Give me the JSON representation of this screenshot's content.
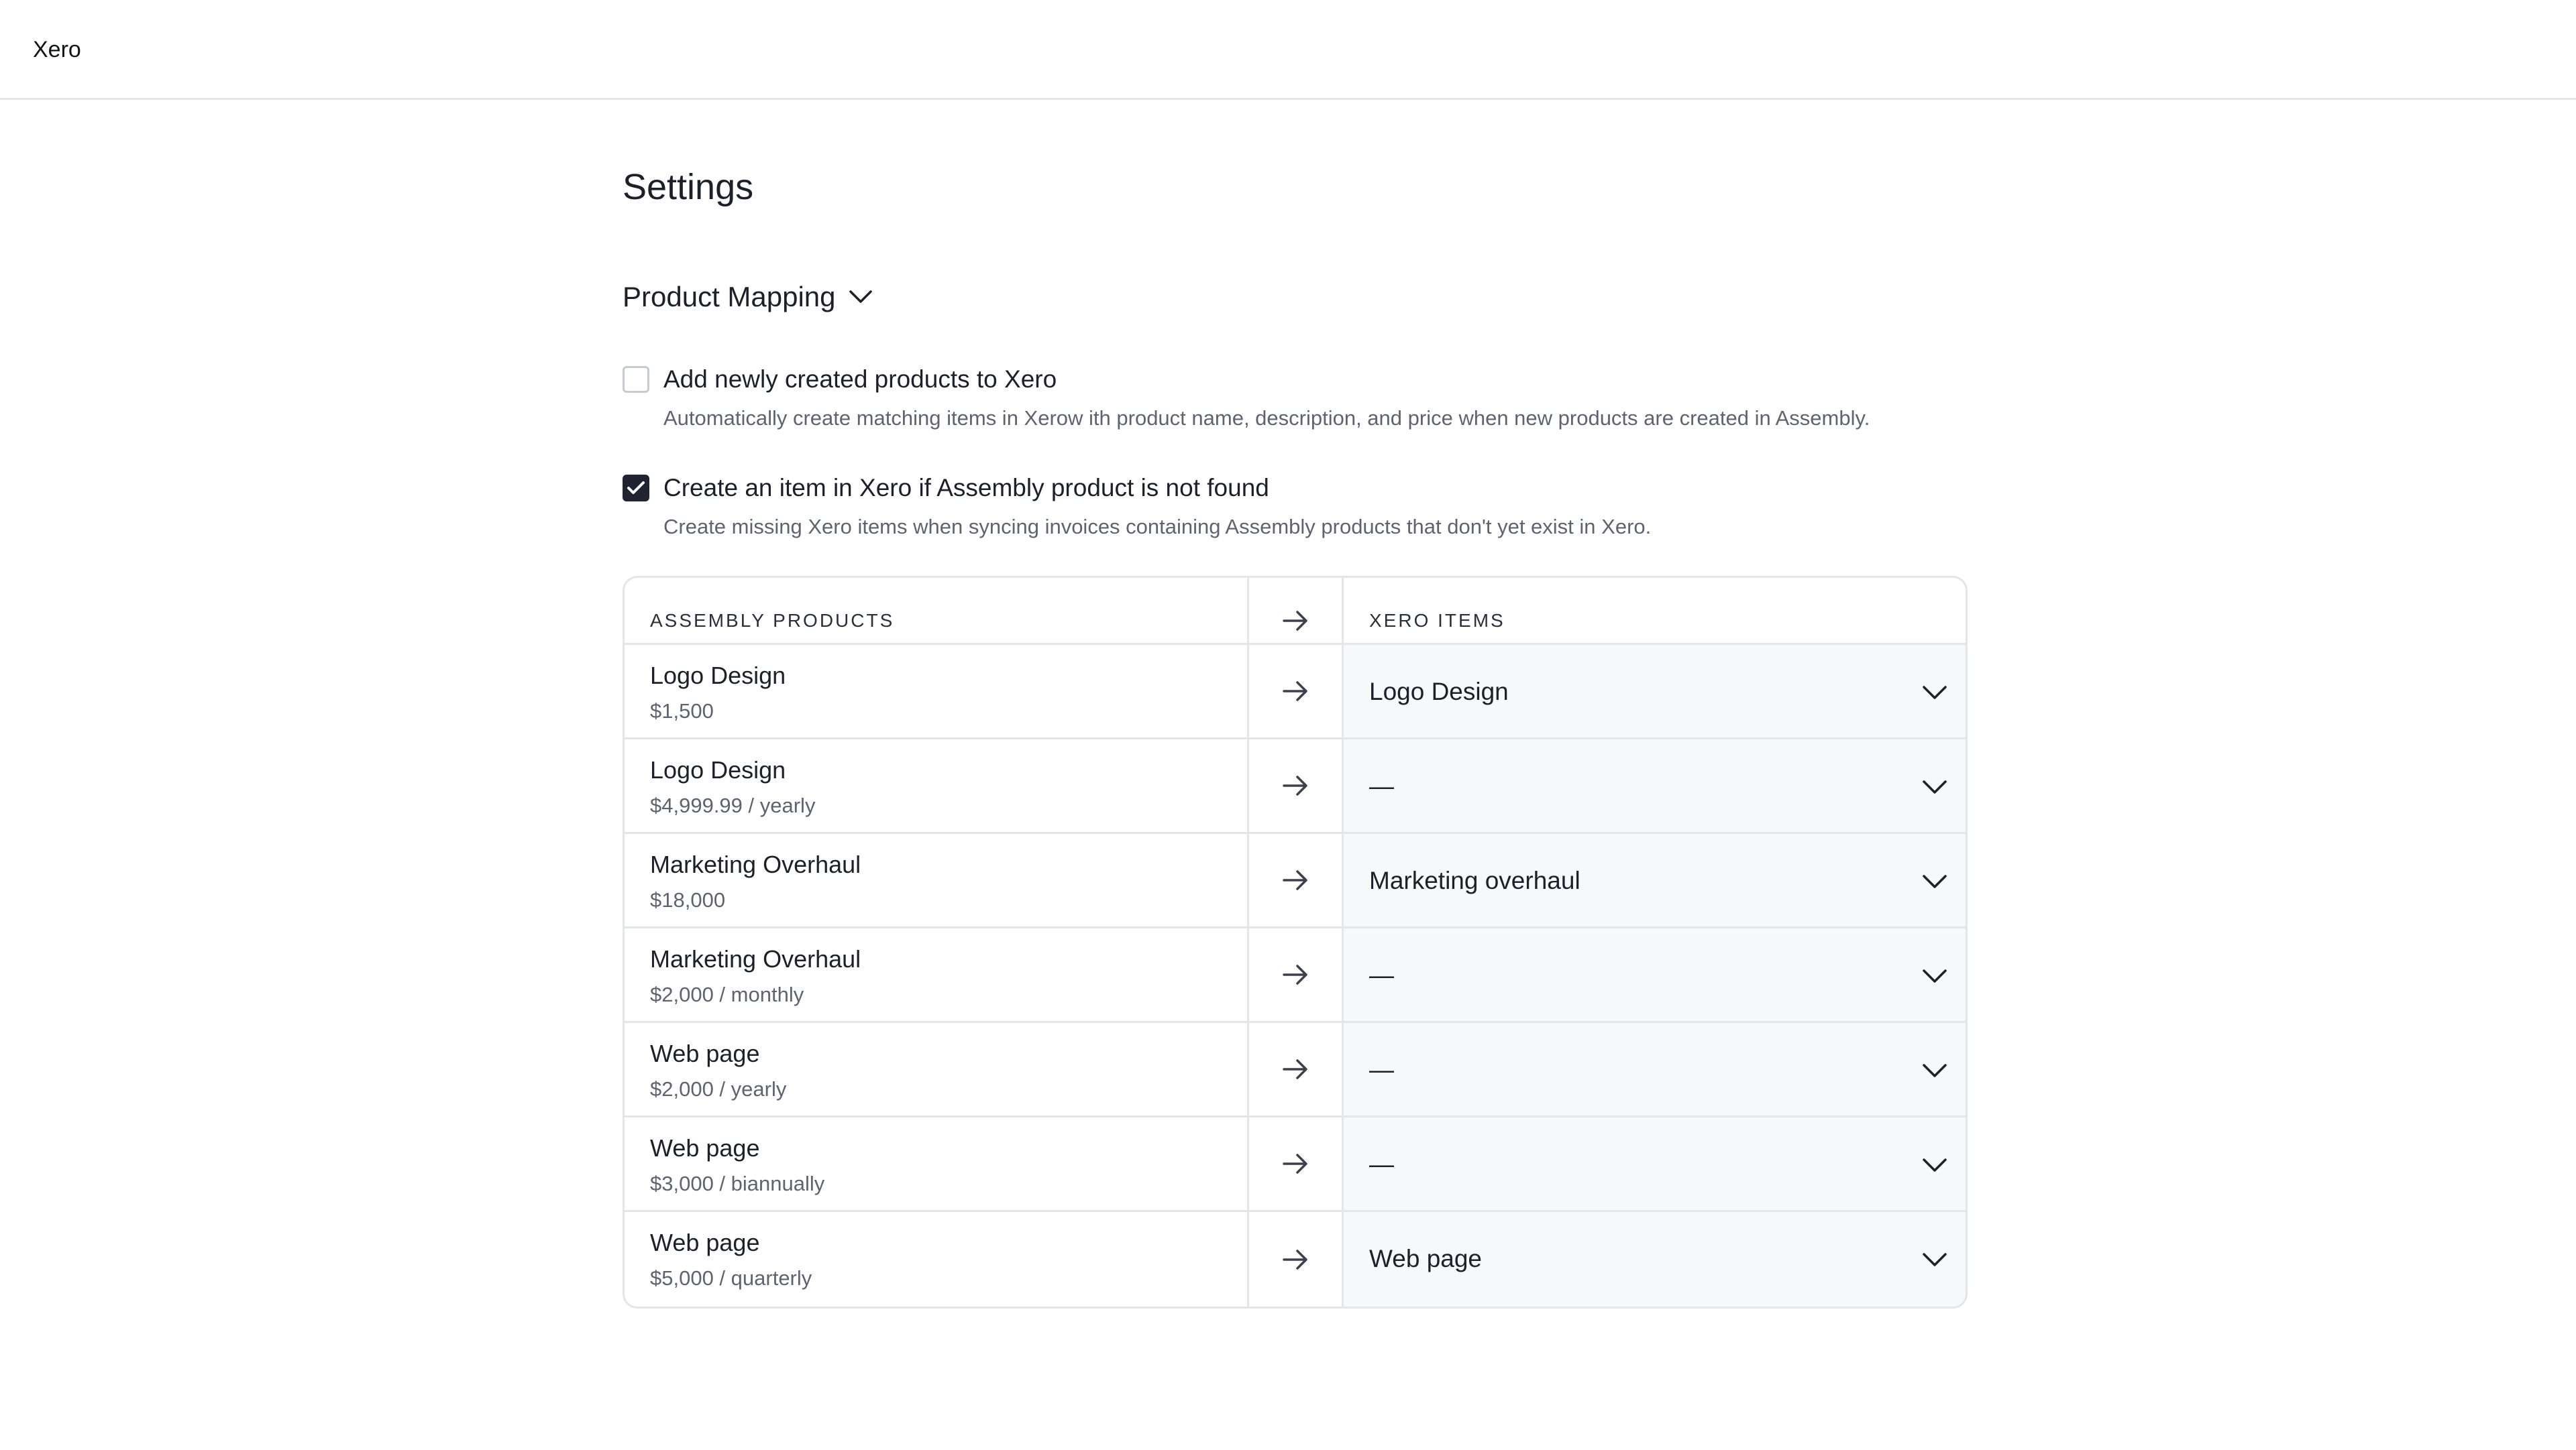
{
  "app": {
    "title": "Xero"
  },
  "page": {
    "title": "Settings"
  },
  "section": {
    "title": "Product Mapping",
    "expanded": true
  },
  "options": [
    {
      "label": "Add newly created products to Xero",
      "description": "Automatically create matching items in Xerow ith product name, description, and price when new products are created in Assembly.",
      "checked": false
    },
    {
      "label": "Create an item in Xero if Assembly product is not found",
      "description": "Create missing Xero items when syncing invoices containing Assembly products that don't yet exist in Xero.",
      "checked": true
    }
  ],
  "table": {
    "left_header": "ASSEMBLY PRODUCTS",
    "right_header": "XERO ITEMS",
    "rows": [
      {
        "product": "Logo Design",
        "price": "$1,500",
        "mapped": "Logo Design"
      },
      {
        "product": "Logo Design",
        "price": "$4,999.99 / yearly",
        "mapped": "—"
      },
      {
        "product": "Marketing Overhaul",
        "price": "$18,000",
        "mapped": "Marketing overhaul"
      },
      {
        "product": "Marketing Overhaul",
        "price": "$2,000 / monthly",
        "mapped": "—"
      },
      {
        "product": "Web page",
        "price": "$2,000 / yearly",
        "mapped": "—"
      },
      {
        "product": "Web page",
        "price": "$3,000 / biannually",
        "mapped": "—"
      },
      {
        "product": "Web page",
        "price": "$5,000 / quarterly",
        "mapped": "Web page"
      }
    ]
  },
  "icons": {
    "section_toggle": "chevron-down-icon",
    "checkbox_checked": "check-icon",
    "row_arrow": "arrow-right-icon",
    "select_toggle": "chevron-down-icon"
  },
  "colors": {
    "checked_fill": "#1f2430",
    "border": "#e3e5e8",
    "select_bg": "#f7f8fa",
    "muted_text": "#5d6470"
  }
}
